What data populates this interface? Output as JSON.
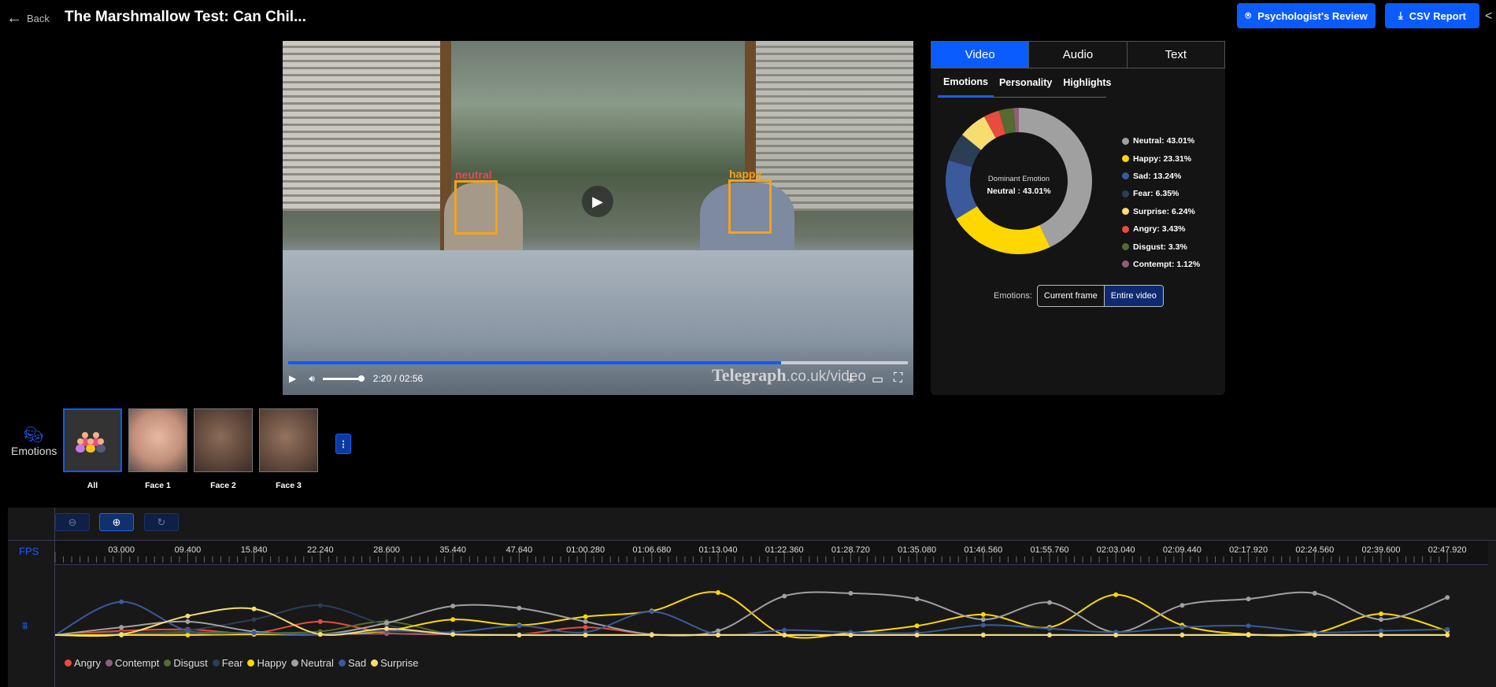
{
  "header": {
    "back_label": "Back",
    "title": "The Marshmallow Test: Can Chil...",
    "review_button": "Psychologist's Review",
    "csv_button": "CSV Report"
  },
  "video": {
    "faces": [
      {
        "label": "neutral",
        "label_color": "#e8485a"
      },
      {
        "label": "happy",
        "label_color": "#f7a11a"
      }
    ],
    "progress": 0.795,
    "time": "2:20 / 02:56",
    "watermark_main": "Telegraph",
    "watermark_suffix": ".co.uk/video"
  },
  "panel": {
    "tabs": [
      {
        "label": "Video",
        "active": true
      },
      {
        "label": "Audio"
      },
      {
        "label": "Text"
      }
    ],
    "subtabs": [
      {
        "label": "Emotions",
        "active": true
      },
      {
        "label": "Personality"
      },
      {
        "label": "Highlights"
      }
    ],
    "dominant_title": "Dominant Emotion",
    "dominant_value": "Neutral : 43.01%",
    "toggle_label": "Emotions:",
    "toggle_options": [
      {
        "label": "Current frame"
      },
      {
        "label": "Entire video",
        "active": true
      }
    ]
  },
  "faces_row": {
    "section_label": "Emotions",
    "items": [
      {
        "label": "All",
        "active": true
      },
      {
        "label": "Face 1"
      },
      {
        "label": "Face 2"
      },
      {
        "label": "Face 3"
      }
    ],
    "more_label": "⋮"
  },
  "timeline": {
    "fps_label": "FPS"
  },
  "chart_data": [
    {
      "type": "pie",
      "subtype": "donut",
      "slices": [
        {
          "name": "Neutral",
          "value": 43.01,
          "label": "Neutral: 43.01%",
          "color": "#a0a0a0"
        },
        {
          "name": "Happy",
          "value": 23.31,
          "label": "Happy: 23.31%",
          "color": "#ffd700"
        },
        {
          "name": "Sad",
          "value": 13.24,
          "label": "Sad: 13.24%",
          "color": "#3a5a9b"
        },
        {
          "name": "Fear",
          "value": 6.35,
          "label": "Fear: 6.35%",
          "color": "#2c3e56"
        },
        {
          "name": "Surprise",
          "value": 6.24,
          "label": "Surprise: 6.24%",
          "color": "#f7dc6f"
        },
        {
          "name": "Angry",
          "value": 3.43,
          "label": "Angry: 3.43%",
          "color": "#e74c3c"
        },
        {
          "name": "Disgust",
          "value": 3.3,
          "label": "Disgust: 3.3%",
          "color": "#556b2f"
        },
        {
          "name": "Contempt",
          "value": 1.12,
          "label": "Contempt: 1.12%",
          "color": "#8e5f7a"
        }
      ],
      "legend": "right"
    },
    {
      "type": "line",
      "smooth": true,
      "legend": "bottom-left",
      "ylim": [
        0,
        1
      ],
      "x": [
        "03.000",
        "09.400",
        "15.840",
        "22.240",
        "28.600",
        "35.440",
        "47.640",
        "01:00.280",
        "01:06.680",
        "01:13.040",
        "01:22.360",
        "01:28.720",
        "01:35.080",
        "01:46.560",
        "01:55.760",
        "02:03.040",
        "02:09.440",
        "02:17.920",
        "02:24.560",
        "02:39.600",
        "02:47.920"
      ],
      "series": [
        {
          "name": "Angry",
          "color": "#e74c3c",
          "values": [
            0.06,
            0.08,
            0.03,
            0.19,
            0.03,
            0.01,
            0.01,
            0.11,
            0.01,
            0,
            0.01,
            0.01,
            0.01,
            0.01,
            0.01,
            0.01,
            0.01,
            0.01,
            0.01,
            0.01,
            0.01
          ]
        },
        {
          "name": "Contempt",
          "color": "#8e5f7a",
          "values": [
            0.01,
            0.01,
            0.01,
            0.01,
            0.02,
            0.01,
            0.01,
            0.01,
            0.01,
            0.01,
            0.01,
            0.01,
            0.01,
            0.01,
            0.01,
            0.01,
            0.01,
            0.01,
            0.01,
            0.01,
            0.01
          ]
        },
        {
          "name": "Disgust",
          "color": "#556b2f",
          "values": [
            0.03,
            0.04,
            0.03,
            0.05,
            0.19,
            0.01,
            0.01,
            0.01,
            0.01,
            0.01,
            0.01,
            0.01,
            0.01,
            0.01,
            0.01,
            0.01,
            0.01,
            0.01,
            0.01,
            0.01,
            0.01
          ]
        },
        {
          "name": "Fear",
          "color": "#2c3e56",
          "values": [
            0.03,
            0.07,
            0.22,
            0.42,
            0.14,
            0.01,
            0.01,
            0.01,
            0.01,
            0.01,
            0.01,
            0.01,
            0.01,
            0.01,
            0.01,
            0.01,
            0.01,
            0.01,
            0.01,
            0.01,
            0.01
          ]
        },
        {
          "name": "Happy",
          "color": "#ffd700",
          "values": [
            0,
            0,
            0.01,
            0.01,
            0.06,
            0.22,
            0.14,
            0.26,
            0.34,
            0.6,
            0,
            0.03,
            0.13,
            0.29,
            0.11,
            0.57,
            0.14,
            0.01,
            0.03,
            0.3,
            0.06
          ]
        },
        {
          "name": "Neutral",
          "color": "#a0a0a0",
          "values": [
            0.11,
            0.19,
            0.05,
            0.01,
            0.17,
            0.41,
            0.38,
            0.19,
            0.01,
            0.06,
            0.55,
            0.59,
            0.51,
            0.22,
            0.46,
            0.04,
            0.42,
            0.51,
            0.59,
            0.22,
            0.53
          ]
        },
        {
          "name": "Sad",
          "color": "#3a5a9b",
          "values": [
            0.47,
            0.06,
            0.03,
            0.01,
            0.06,
            0.04,
            0.13,
            0.04,
            0.33,
            0.01,
            0.07,
            0.04,
            0.03,
            0.14,
            0.09,
            0.04,
            0.11,
            0.13,
            0.04,
            0.06,
            0.08
          ]
        },
        {
          "name": "Surprise",
          "color": "#f7dc6f",
          "values": [
            0.01,
            0.27,
            0.37,
            0.01,
            0.09,
            0.01,
            0,
            0,
            0,
            0,
            0,
            0,
            0,
            0,
            0,
            0,
            0,
            0,
            0,
            0,
            0
          ]
        }
      ]
    }
  ]
}
